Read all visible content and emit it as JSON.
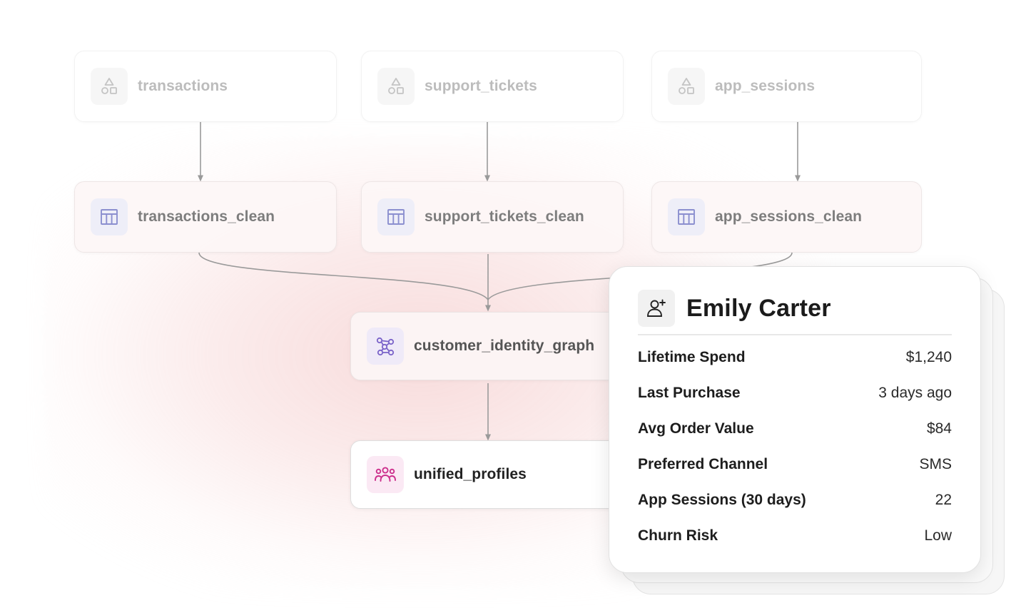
{
  "pipeline": {
    "sources": [
      {
        "label": "transactions",
        "icon": "shapes-icon"
      },
      {
        "label": "support_tickets",
        "icon": "shapes-icon"
      },
      {
        "label": "app_sessions",
        "icon": "shapes-icon"
      }
    ],
    "clean": [
      {
        "label": "transactions_clean",
        "icon": "table-icon"
      },
      {
        "label": "support_tickets_clean",
        "icon": "table-icon"
      },
      {
        "label": "app_sessions_clean",
        "icon": "table-icon"
      }
    ],
    "identity_graph": {
      "label": "customer_identity_graph",
      "icon": "graph-network-icon"
    },
    "unified": {
      "label": "unified_profiles",
      "icon": "users-group-icon"
    }
  },
  "profile_card": {
    "name": "Emily Carter",
    "avatar_icon": "user-plus-icon",
    "rows": [
      {
        "label": "Lifetime Spend",
        "value": "$1,240"
      },
      {
        "label": "Last Purchase",
        "value": "3 days ago"
      },
      {
        "label": "Avg Order Value",
        "value": "$84"
      },
      {
        "label": "Preferred Channel",
        "value": "SMS"
      },
      {
        "label": "App Sessions (30 days)",
        "value": "22"
      },
      {
        "label": "Churn Risk",
        "value": "Low"
      }
    ]
  },
  "colors": {
    "source_icon": "#c4c4c4",
    "table_icon": "#8b8fcf",
    "graph_icon": "#7a63c9",
    "users_icon": "#cc2e8c",
    "edge": "#9a9a9a"
  }
}
